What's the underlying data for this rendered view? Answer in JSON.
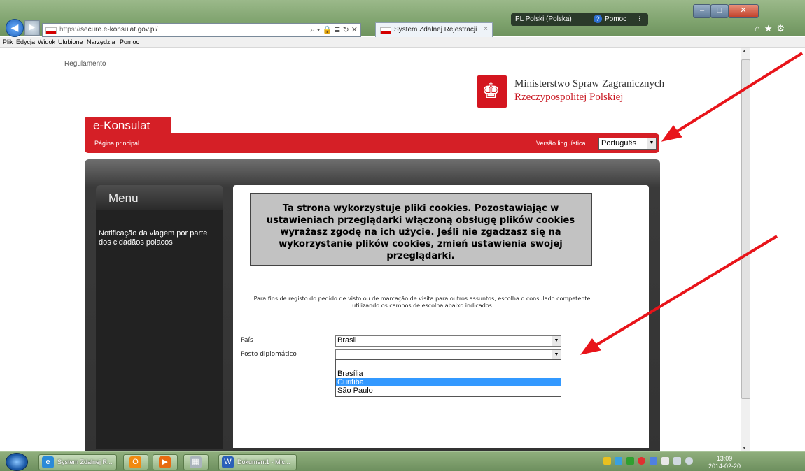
{
  "browser": {
    "url": "https://secure.e-konsulat.gov.pl/",
    "url_prefix": "https://",
    "url_host": "secure.e-konsulat.gov.pl/",
    "tab_title": "System Zdalnej Rejestracji",
    "tab_close": "×",
    "lang_indicator": "PL Polski (Polska)",
    "help_label": "Pomoc",
    "address_tools": "⌕ ▾ 🔒 ≣ ↻ ✕",
    "toolbar_icons": "⌂★⚙",
    "menu": [
      "Plik",
      "Edycja",
      "Widok",
      "Ulubione",
      "Narzędzia",
      "Pomoc"
    ]
  },
  "page": {
    "regulamento": "Regulamento",
    "ministry_line1": "Ministerstwo Spraw Zagranicznych",
    "ministry_line2": "Rzeczypospolitej Polskiej",
    "brand_tab": "e-Konsulat",
    "home_link": "Página principal",
    "version_label": "Versão linguística",
    "language_value": "Português",
    "menu_title": "Menu",
    "menu_item": "Notificação da viagem por parte dos cidadãos polacos",
    "cookie_text": "Ta strona wykorzystuje pliki cookies. Pozostawiając w ustawieniach przeglądarki włączoną obsługę plików cookies wyrażasz zgodę na ich użycie. Jeśli nie zgadzasz się na wykorzystanie plików cookies, zmień ustawienia swojej przeglądarki.",
    "instructions": "Para fins de registo do pedido de visto ou de marcação de visita para outros assuntos, escolha o consulado competente utilizando os campos de escolha abaixo indicados",
    "country_label": "País",
    "country_value": "Brasil",
    "post_label": "Posto diplomático",
    "post_value": "",
    "post_options": [
      "",
      "Brasília",
      "Curitiba",
      "São Paulo"
    ],
    "post_highlighted": "Curitiba"
  },
  "taskbar": {
    "items": [
      "System Zdalnej R...",
      "Dokument1 - Mic..."
    ],
    "time": "13:09",
    "date": "2014-02-20"
  },
  "colors": {
    "brand_red": "#d51f26",
    "annotation_red": "#e8141a",
    "selection_blue": "#3399ff"
  }
}
